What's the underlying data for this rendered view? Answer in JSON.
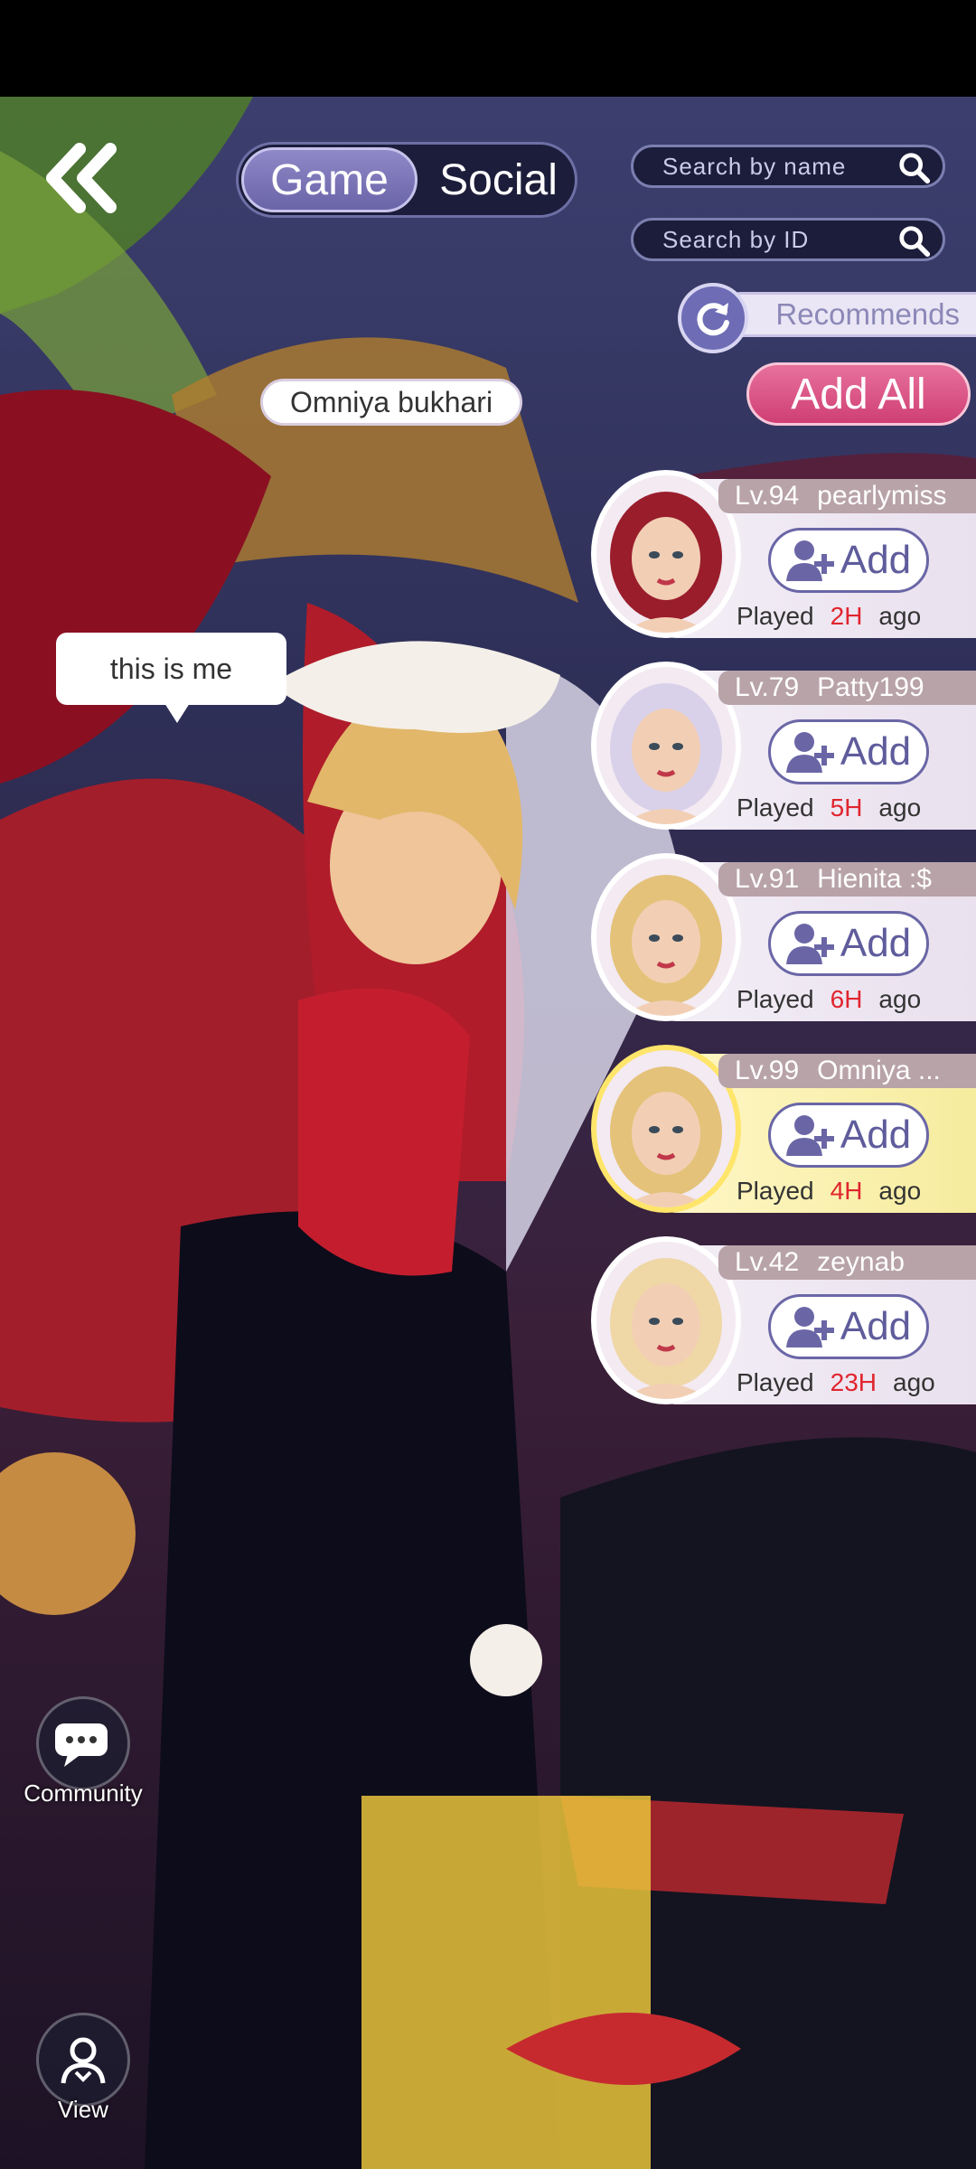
{
  "header": {
    "tabs": [
      {
        "label": "Game",
        "active": true
      },
      {
        "label": "Social",
        "active": false
      }
    ],
    "search_name_placeholder": "Search by name",
    "search_id_placeholder": "Search by ID"
  },
  "recommends_label": "Recommends",
  "add_all_label": "Add All",
  "character": {
    "name": "Omniya bukhari",
    "speech": "this is me"
  },
  "friends": [
    {
      "level": "Lv.94",
      "name": "pearlymiss",
      "add_label": "Add",
      "played": "Played",
      "hours": "2H",
      "ago": "ago",
      "hair": "#9a1d2c"
    },
    {
      "level": "Lv.79",
      "name": "Patty199",
      "add_label": "Add",
      "played": "Played",
      "hours": "5H",
      "ago": "ago",
      "hair": "#d9d1ea"
    },
    {
      "level": "Lv.91",
      "name": "Hienita :$",
      "add_label": "Add",
      "played": "Played",
      "hours": "6H",
      "ago": "ago",
      "hair": "#e4c27a"
    },
    {
      "level": "Lv.99",
      "name": "Omniya ...",
      "add_label": "Add",
      "played": "Played",
      "hours": "4H",
      "ago": "ago",
      "hair": "#e4c27a"
    },
    {
      "level": "Lv.42",
      "name": "zeynab",
      "add_label": "Add",
      "played": "Played",
      "hours": "23H",
      "ago": "ago",
      "hair": "#efd7a6"
    }
  ],
  "side_buttons": {
    "community": "Community",
    "view": "View"
  },
  "colors": {
    "accent": "#6a64a8",
    "add_all": "#d94e80",
    "hours": "#e0252e"
  }
}
